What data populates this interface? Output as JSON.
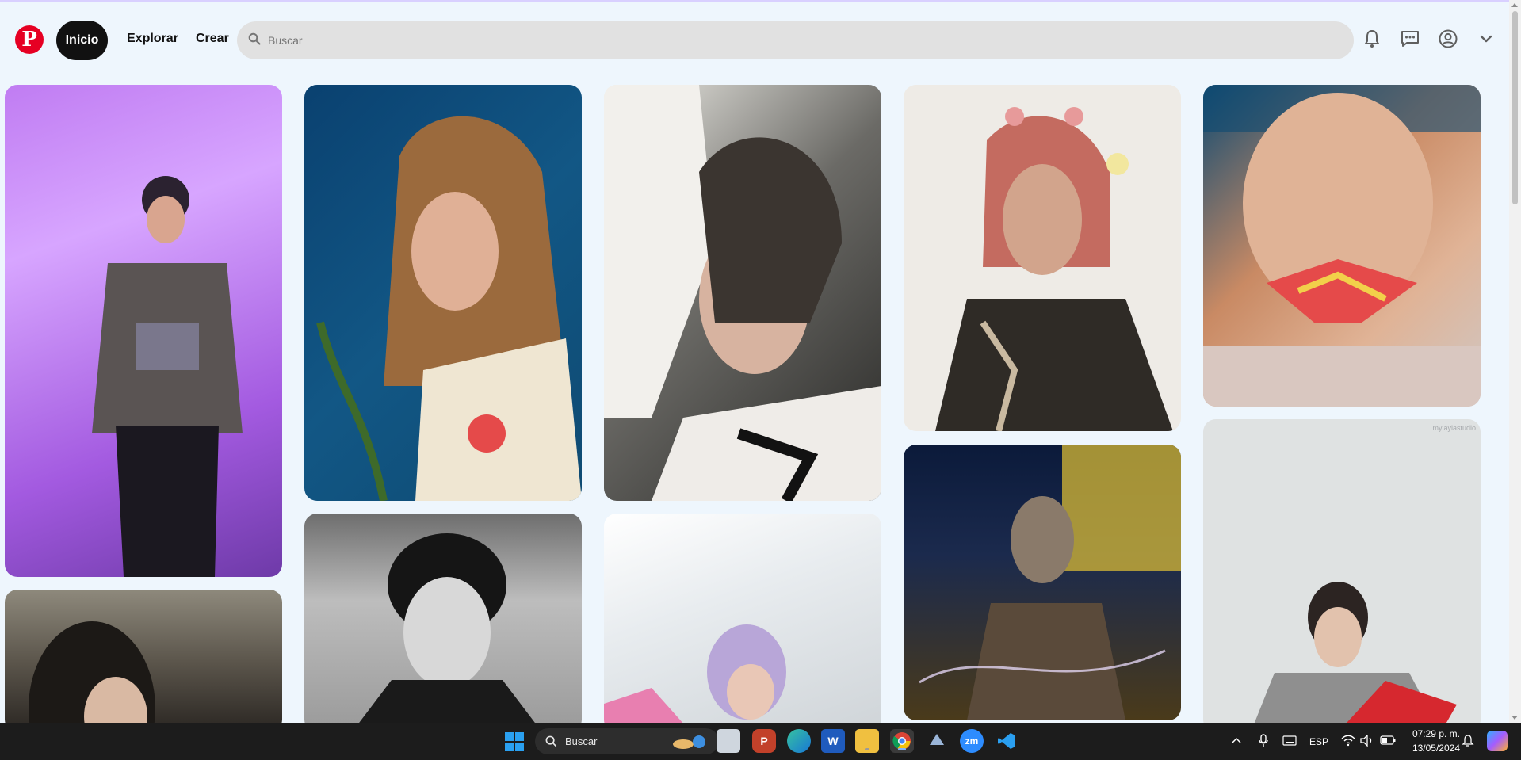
{
  "header": {
    "logo_letter": "P",
    "nav": {
      "home": "Inicio",
      "explore": "Explorar",
      "create": "Crear"
    },
    "search_placeholder": "Buscar",
    "icons": [
      "bell-icon",
      "chat-icon",
      "account-icon",
      "chevron-down-icon"
    ]
  },
  "pins": [
    {
      "id": "concert-man-purple",
      "colors": [
        "#b879f0",
        "#d9a6ff",
        "#7e4bb8"
      ]
    },
    {
      "id": "woman-braids-blue-flowers",
      "colors": [
        "#0f4e7c",
        "#d8a27e",
        "#f2ead6"
      ]
    },
    {
      "id": "woman-white-ruffles",
      "colors": [
        "#3a3a38",
        "#efece8",
        "#121212"
      ]
    },
    {
      "id": "man-pink-hair-flowers",
      "colors": [
        "#eeebe6",
        "#c46b60",
        "#2f2b26"
      ]
    },
    {
      "id": "woman-lily-flower",
      "colors": [
        "#0e4a72",
        "#e0b396",
        "#e54a4a"
      ]
    },
    {
      "id": "woman-restaurant",
      "colors": [
        "#6f6b61",
        "#2b2824",
        "#b9b0a1"
      ]
    },
    {
      "id": "man-bw-portrait",
      "colors": [
        "#9a9a9a",
        "#1a1a1a",
        "#d8d8d8"
      ]
    },
    {
      "id": "woman-purple-hair-selfie",
      "colors": [
        "#e8ecef",
        "#b8a6d8",
        "#e87fb0"
      ]
    },
    {
      "id": "man-yellow-lights",
      "colors": [
        "#0b1a3a",
        "#e6c534",
        "#8a7a6a"
      ]
    },
    {
      "id": "man-grey-sweater",
      "colors": [
        "#dfe2e2",
        "#8f8f8f",
        "#d6282f"
      ]
    }
  ],
  "pin_watermark": "mylaylastudio",
  "taskbar": {
    "search_label": "Buscar",
    "apps": [
      "windows-start",
      "task-view",
      "p-app",
      "edge",
      "word",
      "file-explorer",
      "chrome",
      "proton-vpn",
      "zoom",
      "vscode"
    ],
    "word_letter": "W",
    "zoom_label": "zm",
    "lang": "ESP",
    "time": "07:29 p. m.",
    "date": "13/05/2024"
  }
}
